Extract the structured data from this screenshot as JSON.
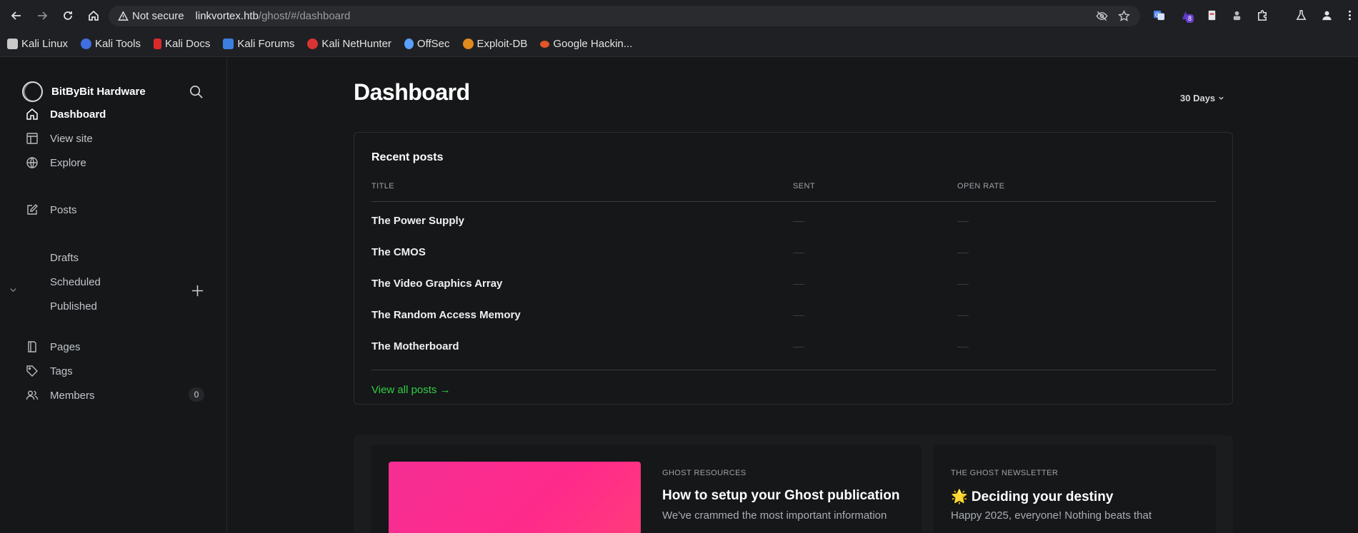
{
  "browser": {
    "security_label": "Not secure",
    "url_host": "linkvortex.htb",
    "url_path": "/ghost/#/dashboard",
    "extension_badge": "8",
    "bookmarks": [
      {
        "label": "Kali Linux",
        "icon": "kali-dragon-icon",
        "color": "#c9c9c9"
      },
      {
        "label": "Kali Tools",
        "icon": "kali-tools-icon",
        "color": "#3f6fe0"
      },
      {
        "label": "Kali Docs",
        "icon": "kali-docs-icon",
        "color": "#d92a2a"
      },
      {
        "label": "Kali Forums",
        "icon": "kali-forums-icon",
        "color": "#3b7fe0"
      },
      {
        "label": "Kali NetHunter",
        "icon": "nethunter-icon",
        "color": "#d93434"
      },
      {
        "label": "OffSec",
        "icon": "offsec-icon",
        "color": "#5aa0ff"
      },
      {
        "label": "Exploit-DB",
        "icon": "exploit-db-icon",
        "color": "#e08a1f"
      },
      {
        "label": "Google Hackin...",
        "icon": "ghdb-icon",
        "color": "#e0552a"
      }
    ]
  },
  "sidebar": {
    "site_name": "BitByBit Hardware",
    "nav": [
      {
        "label": "Dashboard",
        "icon": "home-icon"
      },
      {
        "label": "View site",
        "icon": "layout-icon"
      },
      {
        "label": "Explore",
        "icon": "globe-icon"
      }
    ],
    "posts": {
      "label": "Posts",
      "icon": "edit-icon",
      "sub": [
        "Drafts",
        "Scheduled",
        "Published"
      ]
    },
    "bottom": [
      {
        "label": "Pages",
        "icon": "pages-icon"
      },
      {
        "label": "Tags",
        "icon": "tag-icon"
      },
      {
        "label": "Members",
        "icon": "members-icon",
        "count": "0"
      }
    ]
  },
  "main": {
    "title": "Dashboard",
    "range": "30 Days",
    "recent": {
      "title": "Recent posts",
      "columns": [
        "TITLE",
        "SENT",
        "OPEN RATE"
      ],
      "posts": [
        "The Power Supply",
        "The CMOS",
        "The Video Graphics Array",
        "The Random Access Memory",
        "The Motherboard"
      ],
      "view_all": "View all posts →"
    },
    "resources": {
      "kicker": "GHOST RESOURCES",
      "title": "How to setup your Ghost publication",
      "desc": "We've crammed the most important information"
    },
    "newsletter": {
      "kicker": "THE GHOST NEWSLETTER",
      "title": "🌟 Deciding your destiny",
      "desc": "Happy 2025, everyone! Nothing beats that"
    }
  },
  "colors": {
    "accent_green": "#30cf43",
    "background": "#151719"
  }
}
